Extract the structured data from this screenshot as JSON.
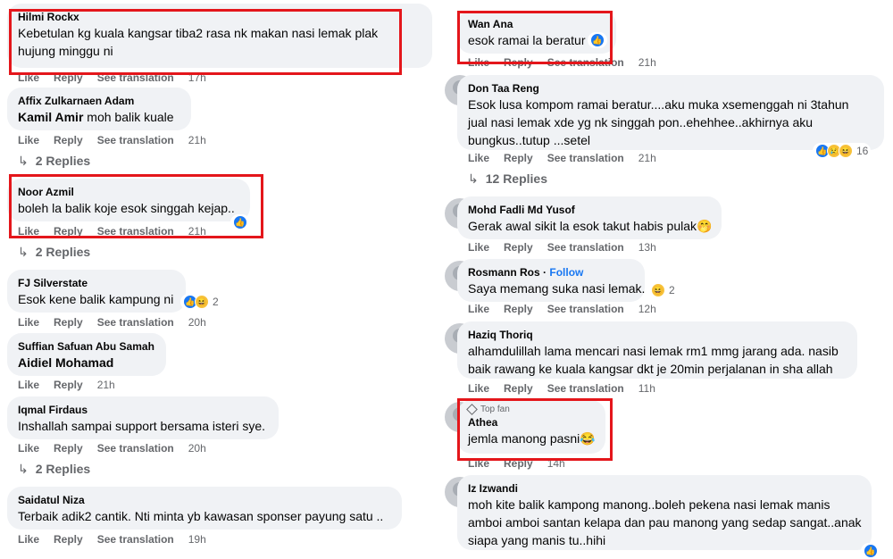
{
  "labels": {
    "like": "Like",
    "reply": "Reply",
    "see_translation": "See translation"
  },
  "left": {
    "c1": {
      "name": "Hilmi Rockx",
      "line1": "Kebetulan kg kuala kangsar tiba2 rasa nk makan nasi lemak plak",
      "line2": "hujung minggu ni",
      "time": "17h"
    },
    "c2": {
      "name": "Affix Zulkarnaen Adam",
      "tag": "Kamil Amir",
      "text": "moh balik kuale",
      "time": "21h",
      "replies": "2 Replies"
    },
    "c3": {
      "name": "Noor Azmil",
      "text": "boleh la balik koje esok singgah kejap..",
      "time": "21h",
      "replies": "2 Replies"
    },
    "c4": {
      "name": "FJ Silverstate",
      "text": "Esok kene balik kampung ni",
      "time": "20h",
      "react_count": "2"
    },
    "c5": {
      "name": "Suffian Safuan Abu Samah",
      "tag": "Aidiel Mohamad",
      "time": "21h"
    },
    "c6": {
      "name": "Iqmal Firdaus",
      "text": "Inshallah sampai support bersama isteri sye.",
      "time": "20h",
      "replies": "2 Replies"
    },
    "c7": {
      "name": "Saidatul Niza",
      "text": "Terbaik adik2 cantik. Nti minta yb kawasan sponser payung satu ..",
      "time": "19h"
    }
  },
  "right": {
    "c1": {
      "name": "Wan Ana",
      "text": "esok ramai la beratur",
      "time": "21h"
    },
    "c2": {
      "name": "Don Taa Reng",
      "line1": "Esok lusa kompom ramai beratur....aku muka xsemenggah ni 3tahun",
      "line2": "jual nasi lemak xde yg nk singgah pon..ehehhee..akhirnya aku",
      "line3": "bungkus..tutup ...setel",
      "time": "21h",
      "react_count": "16",
      "replies": "12 Replies"
    },
    "c3": {
      "name": "Mohd Fadli Md Yusof",
      "text": "Gerak awal sikit la esok takut habis pulak",
      "time": "13h"
    },
    "c4": {
      "name": "Rosmann Ros",
      "follow": "Follow",
      "text": "Saya memang suka nasi lemak.",
      "time": "12h",
      "react_count": "2"
    },
    "c5": {
      "name": "Haziq Thoriq",
      "line1": "alhamdulillah lama mencari nasi lemak rm1 mmg jarang ada. nasib",
      "line2": "baik rawang ke kuala kangsar dkt je 20min perjalanan in sha allah",
      "time": "11h"
    },
    "c6": {
      "badge": "Top fan",
      "name": "Athea",
      "text": "jemla manong pasni",
      "time": "14h"
    },
    "c7": {
      "name": "Iz Izwandi",
      "line1": "moh kite balik kampong manong..boleh pekena nasi lemak manis",
      "line2": "amboi amboi santan kelapa dan pau manong yang sedap sangat..anak",
      "line3": "siapa yang manis tu..hihi"
    }
  },
  "colors": {
    "highlight": "#e4161b",
    "bubble": "#f0f2f5",
    "link": "#1877f2",
    "meta": "#65676b"
  },
  "icons": [
    "reply-arrow-icon",
    "like-reaction-icon",
    "haha-reaction-icon",
    "sad-reaction-icon",
    "top-fan-gem-icon"
  ]
}
